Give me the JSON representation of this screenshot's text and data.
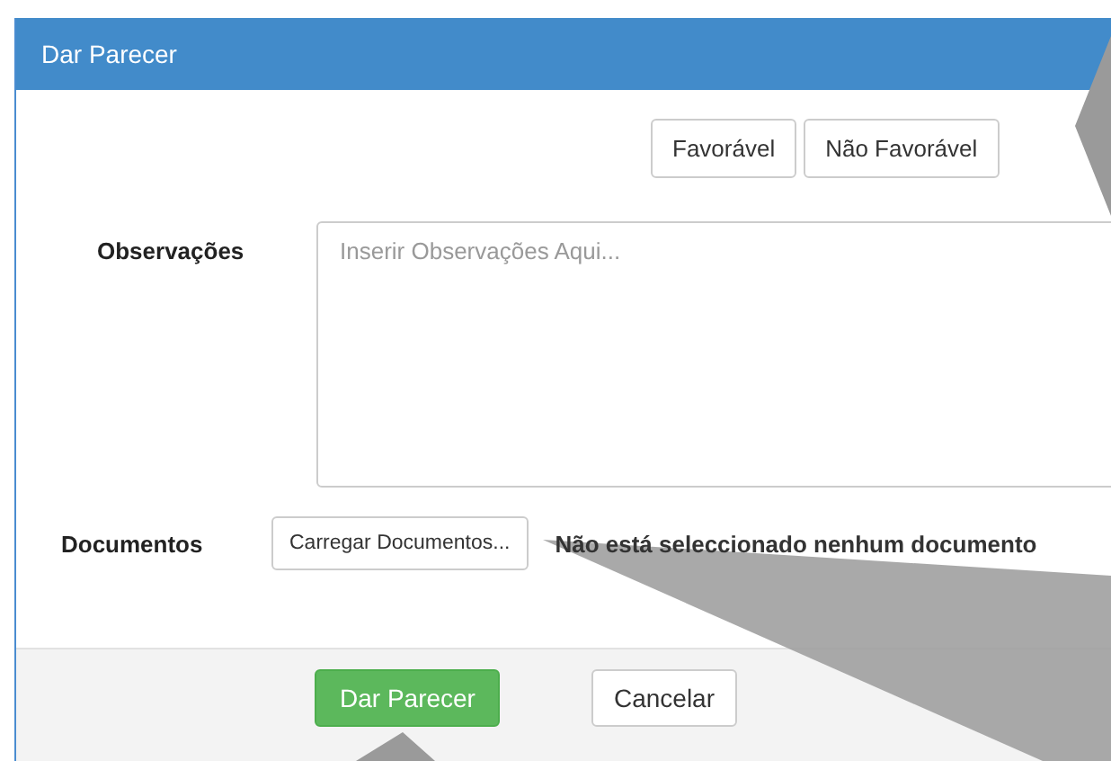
{
  "dialog": {
    "title": "Dar Parecer",
    "verdict_buttons": [
      {
        "label": "Favorável"
      },
      {
        "label": "Não Favorável"
      }
    ],
    "observations": {
      "label": "Observações",
      "placeholder": "Inserir Observações Aqui..."
    },
    "documents": {
      "label": "Documentos",
      "button": "Carregar Documentos...",
      "status": "Não está seleccionado nenhum documento"
    },
    "footer_buttons": [
      {
        "label": "Dar Parecer",
        "kind": "primary"
      },
      {
        "label": "Cancelar",
        "kind": "default"
      }
    ]
  }
}
